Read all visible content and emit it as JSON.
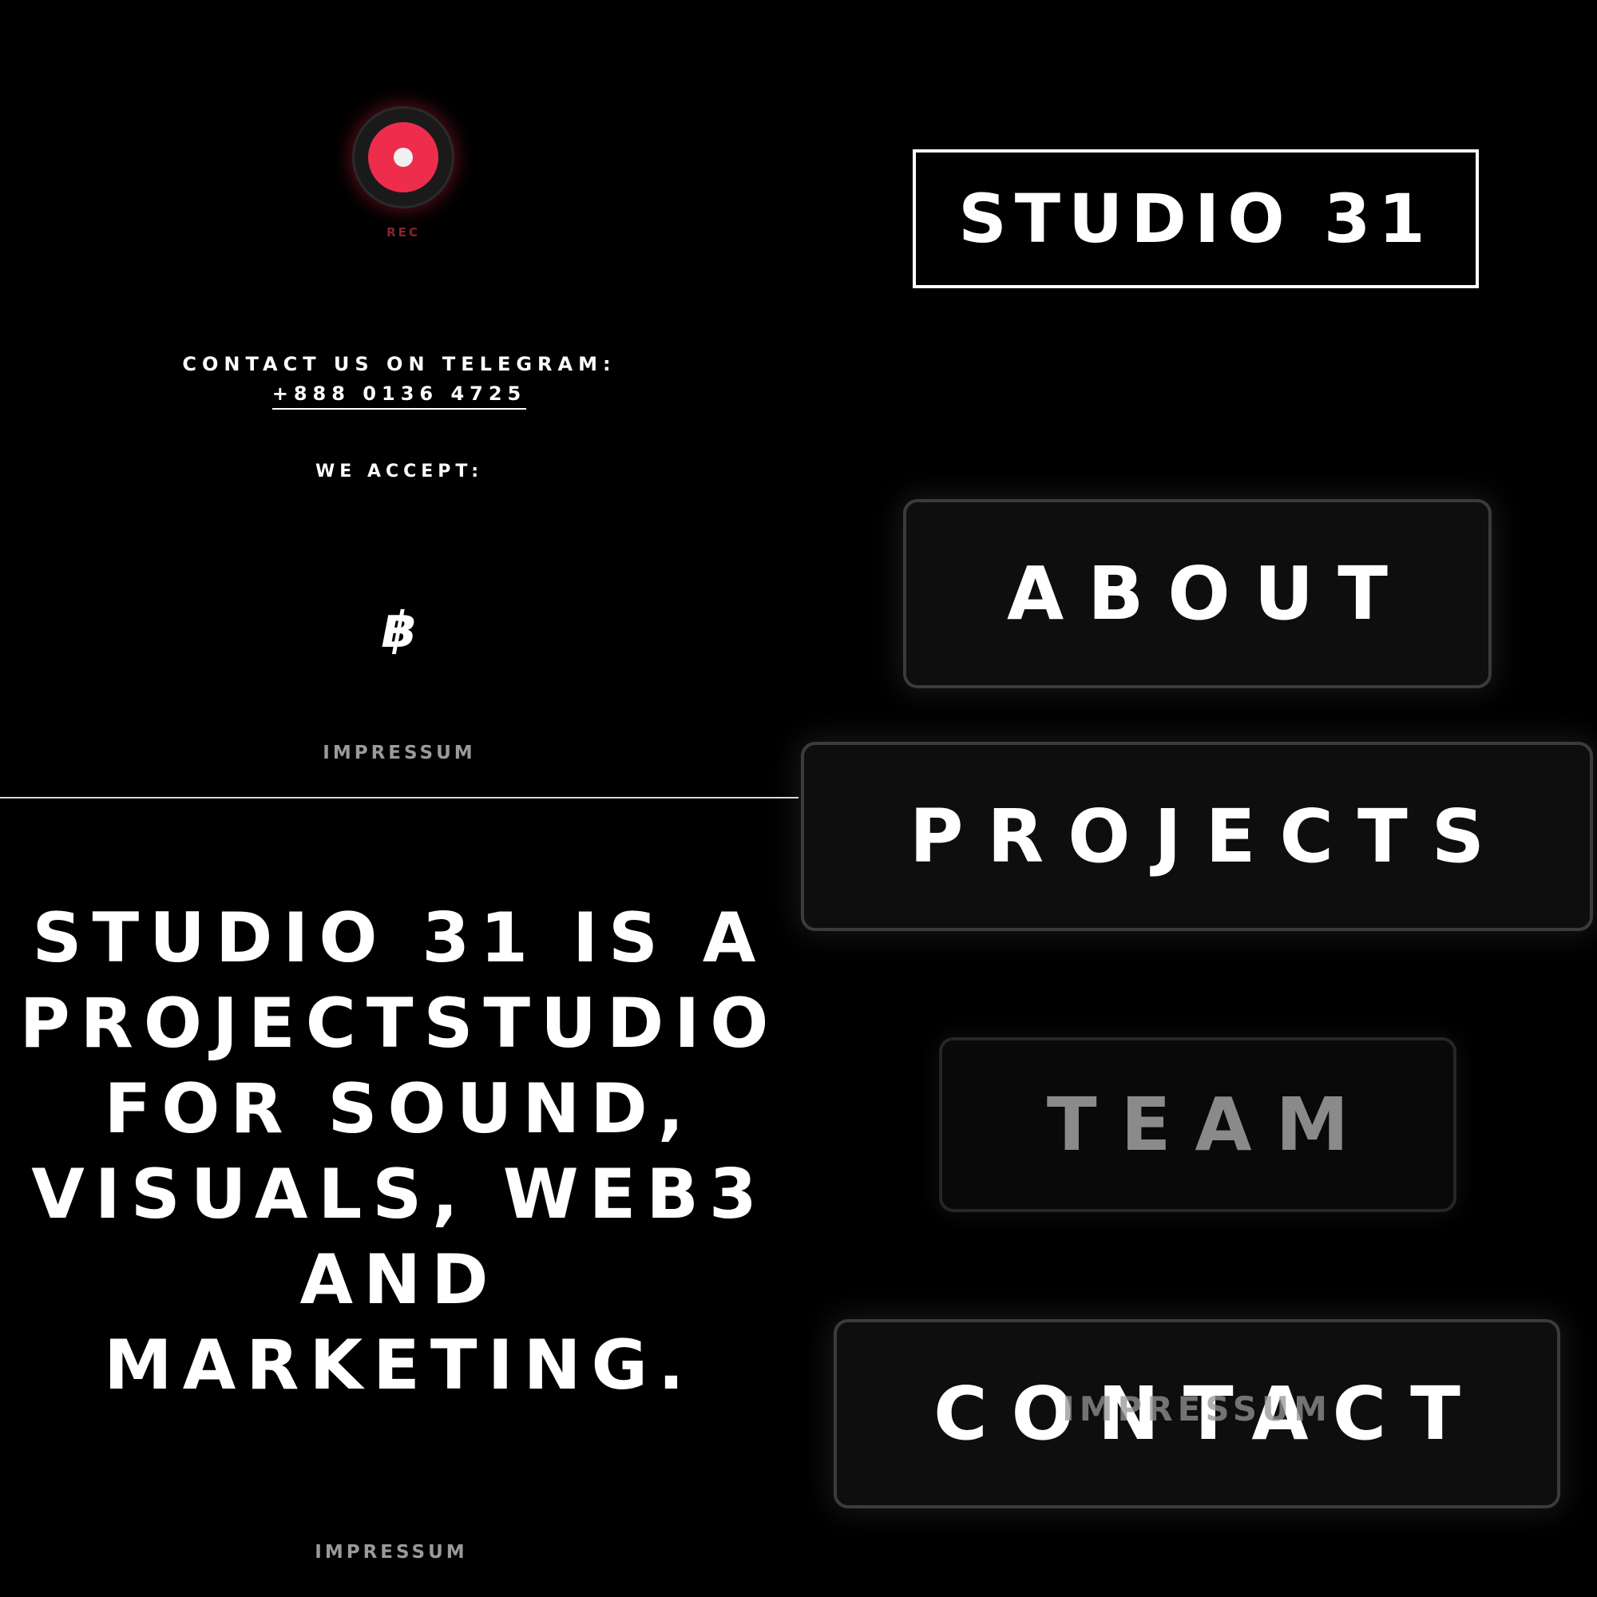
{
  "recorder": {
    "label": "REC",
    "icon": "record-icon",
    "accent_color": "#ee2d4d"
  },
  "contact": {
    "line1": "CONTACT US ON TELEGRAM:",
    "phone": "+888 0136 4725"
  },
  "payment": {
    "heading": "WE ACCEPT:",
    "bitcoin_glyph": "฿",
    "icon": "bitcoin-icon"
  },
  "footer": {
    "impressum_top": "IMPRESSUM",
    "impressum_bottom": "IMPRESSUM",
    "impressum_overlay": "IMPRESSUM"
  },
  "statement": {
    "lines": [
      "STUDIO 31 IS A",
      "PROJECTSTUDIO",
      "FOR SOUND,",
      "VISUALS, WEB3",
      "AND",
      "MARKETING."
    ]
  },
  "brand": {
    "logo_text": "STUDIO 31"
  },
  "nav": {
    "about": "ABOUT",
    "projects": "PROJECTS",
    "team": "TEAM",
    "contact": "CONTACT"
  }
}
